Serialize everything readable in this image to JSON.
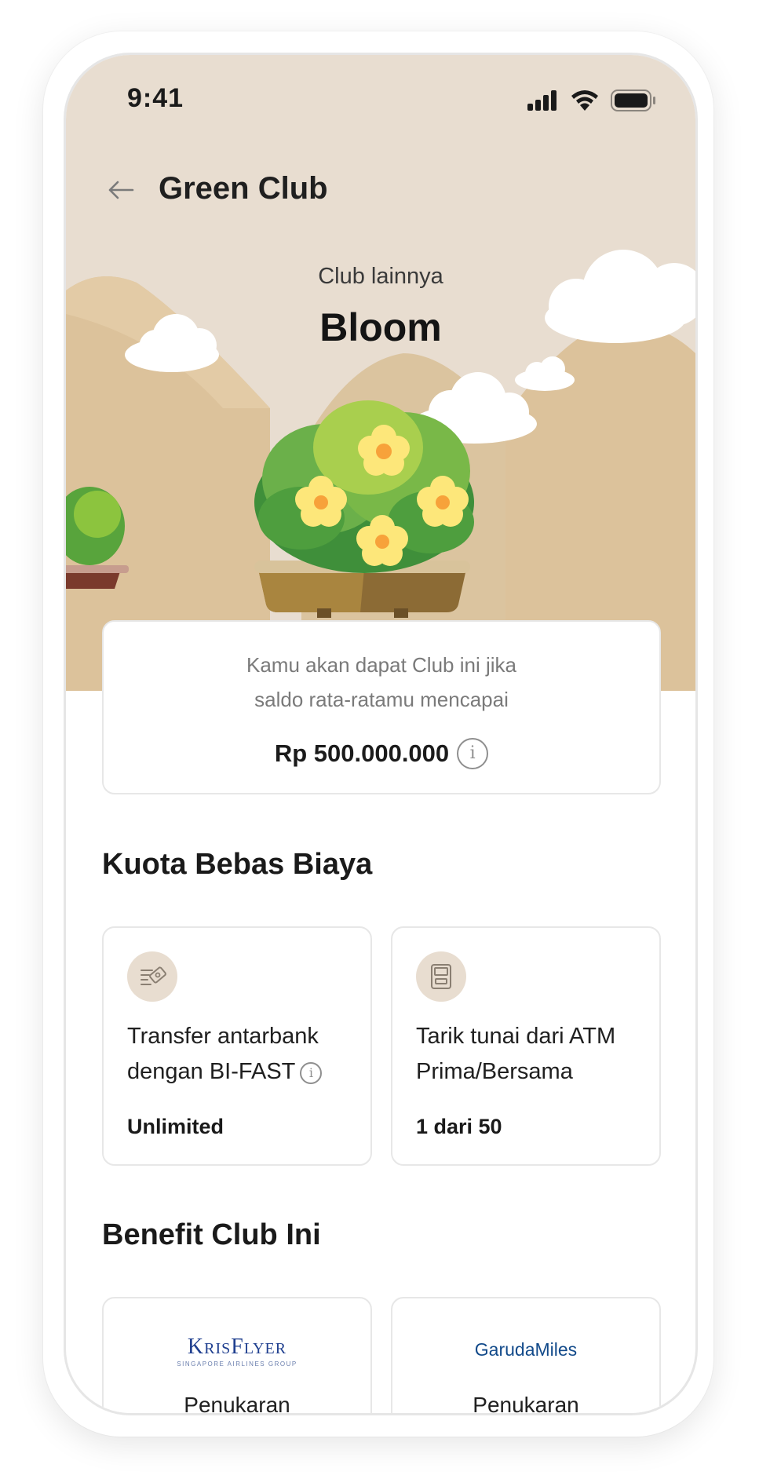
{
  "status_bar": {
    "time": "9:41"
  },
  "header": {
    "title": "Green Club"
  },
  "club": {
    "subtitle": "Club lainnya",
    "name": "Bloom"
  },
  "requirement": {
    "line1": "Kamu akan dapat Club ini jika",
    "line2": "saldo rata-ratamu mencapai",
    "amount": "Rp 500.000.000"
  },
  "quota": {
    "title": "Kuota Bebas Biaya",
    "items": [
      {
        "label": "Transfer antarbank dengan BI-FAST",
        "value": "Unlimited",
        "icon": "transfer-icon"
      },
      {
        "label": "Tarik tunai dari ATM Prima/Bersama",
        "value": "1 dari 50",
        "icon": "atm-icon"
      }
    ]
  },
  "benefits": {
    "title": "Benefit Club Ini",
    "items": [
      {
        "logo_main": "KrisFlyer",
        "logo_sub": "SINGAPORE AIRLINES GROUP",
        "label": "Penukaran"
      },
      {
        "logo_main": "GarudaMiles",
        "label": "Penukaran"
      }
    ]
  },
  "colors": {
    "hero_bg": "#e8ddd0",
    "mountain": "#dcc29b",
    "leaf_dark": "#3f8f3a",
    "leaf_light": "#a9cf4e",
    "flower": "#fde77a",
    "flower_center": "#f7a23a",
    "pot": "#a07a3e",
    "krisflyer_blue": "#1f3f8f",
    "garuda_blue": "#124a8a"
  }
}
